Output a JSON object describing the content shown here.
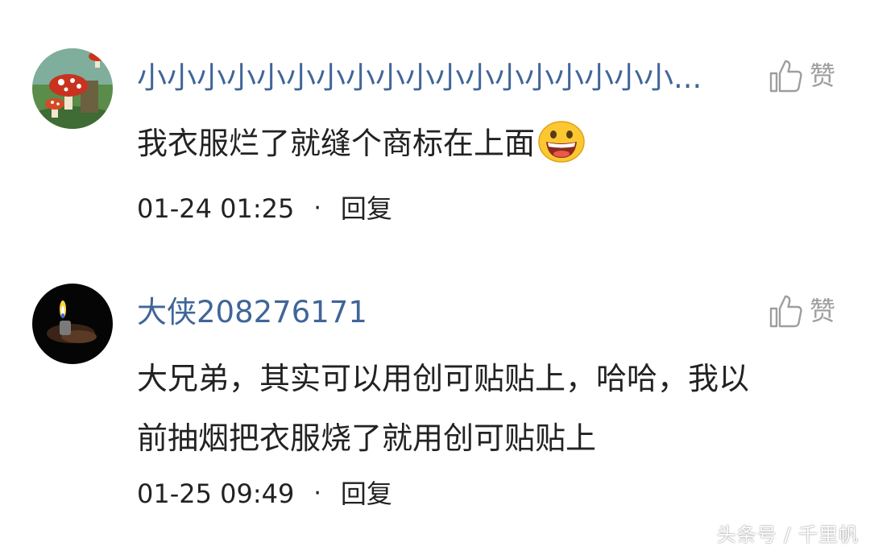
{
  "comments": [
    {
      "username": "小小小小小小小小小小小小小小小小小小...",
      "like_label": "赞",
      "text": "我衣服烂了就缝个商标在上面",
      "emoji": "grinning-face",
      "time": "01-24 01:25",
      "separator": "·",
      "reply_label": "回复"
    },
    {
      "username": "大侠208276171",
      "like_label": "赞",
      "text_lines": [
        "大兄弟，其实可以用创可贴贴上，哈哈，我以",
        "前抽烟把衣服烧了就用创可贴贴上"
      ],
      "time": "01-25 09:49",
      "separator": "·",
      "reply_label": "回复"
    }
  ],
  "watermark": "头条号 / 千里帆",
  "colors": {
    "username": "#406599",
    "text": "#222222",
    "icon": "#9e9e9e"
  }
}
